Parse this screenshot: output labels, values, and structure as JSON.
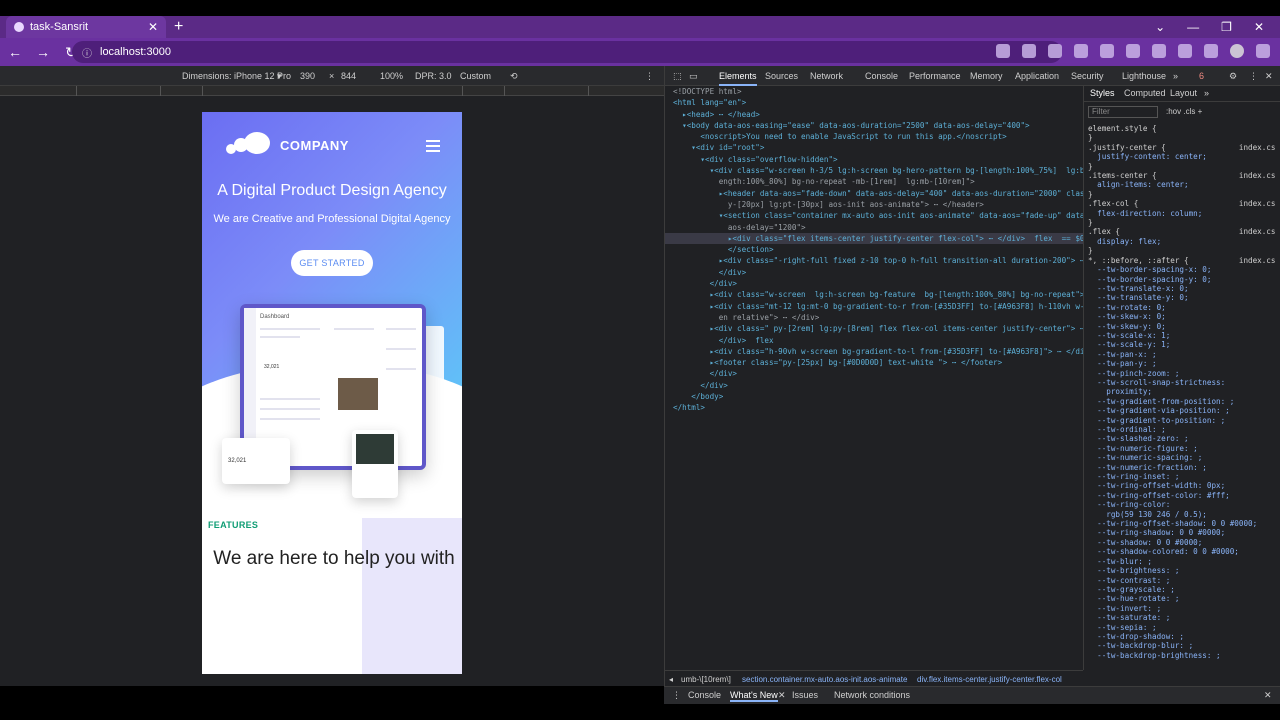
{
  "browser": {
    "tab_title": "task-Sansrit",
    "url": "localhost:3000"
  },
  "device_toolbar": {
    "dimensions": "Dimensions: iPhone 12 Pro",
    "width": "390",
    "times": "×",
    "height": "844",
    "zoom": "100%",
    "dpr": "DPR: 3.0",
    "throttle": "Custom"
  },
  "page": {
    "logo_text": "COMPANY",
    "hero_title": "A Digital Product Design Agency",
    "hero_subtitle": "We are Creative and Professional Digital Agency",
    "cta_label": "GET STARTED",
    "mock_header": "Dashboard",
    "mock_value_1": "32,021",
    "mock_value_2": "32,021",
    "features_label": "FEATURES",
    "help_text": "We are here to help you with"
  },
  "devtools": {
    "tabs": [
      "Elements",
      "Sources",
      "Network",
      "Console",
      "Performance",
      "Memory",
      "Application",
      "Security",
      "Lighthouse"
    ],
    "error_count": "6",
    "dom_lines": [
      "<!DOCTYPE html>",
      "<html lang=\"en\">",
      "  ▸<head> ⋯ </head>",
      "  ▾<body data-aos-easing=\"ease\" data-aos-duration=\"2500\" data-aos-delay=\"400\">",
      "      <noscript>You need to enable JavaScript to run this app.</noscript>",
      "    ▾<div id=\"root\">",
      "      ▾<div class=\"overflow-hidden\">",
      "        ▾<div class=\"w-screen h-3/5 lg:h-screen bg-hero-pattern bg-[length:100%_75%]  lg:bg-[l",
      "          ength:100%_80%] bg-no-repeat -mb-[1rem]  lg:mb-[10rem]\">",
      "          ▸<header data-aos=\"fade-down\" data-aos-delay=\"400\" data-aos-duration=\"2000\" class=\"p",
      "            y-[20px] lg:pt-[30px] aos-init aos-animate\"> ⋯ </header>",
      "          ▾<section class=\"container mx-auto aos-init aos-animate\" data-aos=\"fade-up\" data-",
      "            aos-delay=\"1200\">",
      "            ▸<div class=\"flex items-center justify-center flex-col\"> ⋯ </div>  flex  == $0",
      "            </section>",
      "          ▸<div class=\"-right-full fixed z-10 top-0 h-full transition-all duration-200\"> ⋯ </div>",
      "          </div>",
      "        </div>",
      "        ▸<div class=\"w-screen  lg:h-screen bg-feature  bg-[length:100%_80%] bg-no-repeat\"> ⋯ </div>",
      "        ▸<div class=\"mt-12 lg:mt-0 bg-gradient-to-r from-[#35D3FF] to-[#A963F8] h-110vh w-scre",
      "          en relative\"> ⋯ </div>",
      "        ▸<div class=\" py-[2rem] lg:py-[8rem] flex flex-col items-center justify-center\"> ⋯",
      "          </div>  flex",
      "        ▸<div class=\"h-90vh w-screen bg-gradient-to-l from-[#35D3FF] to-[#A963F8]\"> ⋯ </div>",
      "        ▸<footer class=\"py-[25px] bg-[#0D0D0D] text-white \"> ⋯ </footer>",
      "        </div>",
      "      </div>",
      "    </body>",
      "</html>"
    ],
    "styles_tabs": [
      "Styles",
      "Computed",
      "Layout"
    ],
    "filter_placeholder": "Filter",
    "filter_tools": ":hov  .cls  +",
    "style_lines": [
      "element.style {",
      "}",
      ".justify-center {                index.css:3",
      "  justify-content: center;",
      "}",
      ".items-center {                  index.css:3",
      "  align-items: center;",
      "}",
      ".flex-col {                      index.css:3",
      "  flex-direction: column;",
      "}",
      ".flex {                          index.css:3",
      "  display: flex;",
      "}",
      "*, ::before, ::after {           index.css:1",
      "  --tw-border-spacing-x: 0;",
      "  --tw-border-spacing-y: 0;",
      "  --tw-translate-x: 0;",
      "  --tw-translate-y: 0;",
      "  --tw-rotate: 0;",
      "  --tw-skew-x: 0;",
      "  --tw-skew-y: 0;",
      "  --tw-scale-x: 1;",
      "  --tw-scale-y: 1;",
      "  --tw-pan-x: ;",
      "  --tw-pan-y: ;",
      "  --tw-pinch-zoom: ;",
      "  --tw-scroll-snap-strictness:",
      "    proximity;",
      "  --tw-gradient-from-position: ;",
      "  --tw-gradient-via-position: ;",
      "  --tw-gradient-to-position: ;",
      "  --tw-ordinal: ;",
      "  --tw-slashed-zero: ;",
      "  --tw-numeric-figure: ;",
      "  --tw-numeric-spacing: ;",
      "  --tw-numeric-fraction: ;",
      "  --tw-ring-inset: ;",
      "  --tw-ring-offset-width: 0px;",
      "  --tw-ring-offset-color: #fff;",
      "  --tw-ring-color:",
      "    rgb(59 130 246 / 0.5);",
      "  --tw-ring-offset-shadow: 0 0 #0000;",
      "  --tw-ring-shadow: 0 0 #0000;",
      "  --tw-shadow: 0 0 #0000;",
      "  --tw-shadow-colored: 0 0 #0000;",
      "  --tw-blur: ;",
      "  --tw-brightness: ;",
      "  --tw-contrast: ;",
      "  --tw-grayscale: ;",
      "  --tw-hue-rotate: ;",
      "  --tw-invert: ;",
      "  --tw-saturate: ;",
      "  --tw-sepia: ;",
      "  --tw-drop-shadow: ;",
      "  --tw-backdrop-blur: ;",
      "  --tw-backdrop-brightness: ;"
    ],
    "breadcrumbs": [
      "umb-\\[10rem\\]",
      "section.container.mx-auto.aos-init.aos-animate",
      "div.flex.items-center.justify-center.flex-col"
    ],
    "drawer_tabs": [
      "Console",
      "What's New",
      "Issues",
      "Network conditions"
    ]
  },
  "colors": {
    "browser_purple": "#6a31a0",
    "hero_gradient_start": "#6b6ef2",
    "hero_gradient_end": "#5fc3f8",
    "features_green": "#0f9d74"
  }
}
